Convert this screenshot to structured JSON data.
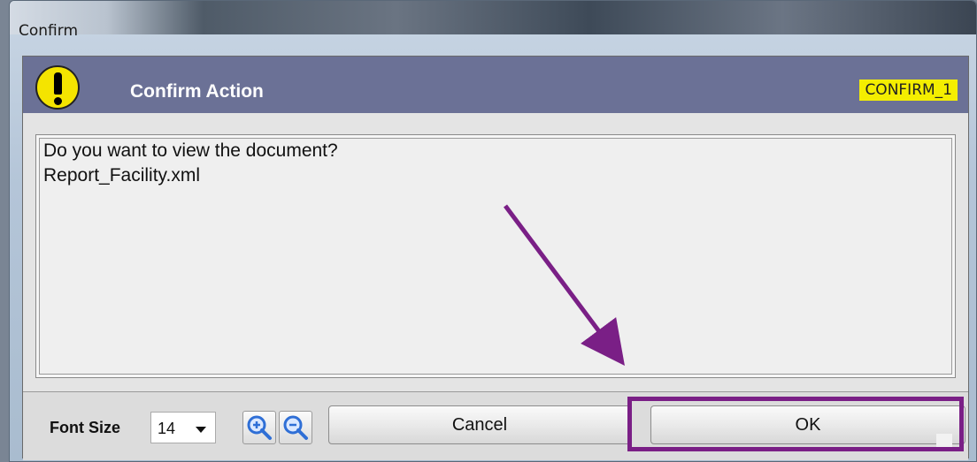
{
  "window": {
    "title": "Confirm"
  },
  "header": {
    "title": "Confirm Action",
    "code": "CONFIRM_1",
    "icon": "warning-icon"
  },
  "message": {
    "lines": [
      "Do you want to view the document?",
      "Report_Facility.xml"
    ]
  },
  "footer": {
    "font_size_label": "Font Size",
    "font_size_value": "14",
    "zoom_in_icon": "zoom-in-icon",
    "zoom_out_icon": "zoom-out-icon",
    "cancel_label": "Cancel",
    "ok_label": "OK"
  },
  "colors": {
    "header_bg": "#6b7196",
    "badge_bg": "#f4ee00",
    "annotation": "#7a1f86"
  }
}
